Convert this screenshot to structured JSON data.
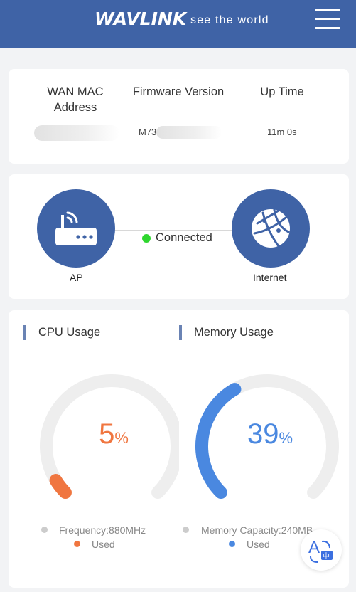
{
  "header": {
    "logo": "WAVLINK",
    "tagline": "see the world",
    "menu_icon": "hamburger-menu-icon"
  },
  "info": {
    "wan_mac_label": "WAN MAC\nAddress",
    "wan_mac_label_line1": "WAN MAC",
    "wan_mac_label_line2": "Address",
    "firmware_label": "Firmware Version",
    "firmware_value": "M73",
    "uptime_label": "Up Time",
    "uptime_value": "11m 0s"
  },
  "network": {
    "ap_label": "AP",
    "ap_icon": "router-icon",
    "status": "Connected",
    "status_color": "#2ed62e",
    "internet_label": "Internet",
    "internet_icon": "globe-icon"
  },
  "cpu": {
    "title": "CPU Usage",
    "percent": 5,
    "percent_text": "5",
    "percent_sign": "%",
    "color": "#f07640",
    "frequency_label": "Frequency:880MHz",
    "used_label": "Used"
  },
  "memory": {
    "title": "Memory Usage",
    "percent": 39,
    "percent_text": "39",
    "percent_sign": "%",
    "color": "#4a88e0",
    "capacity_label": "Memory Capacity:240MB",
    "used_label": "Used"
  },
  "colors": {
    "brand": "#3f63a6",
    "track": "#eeeeee"
  },
  "translate_icon": "translate-icon"
}
